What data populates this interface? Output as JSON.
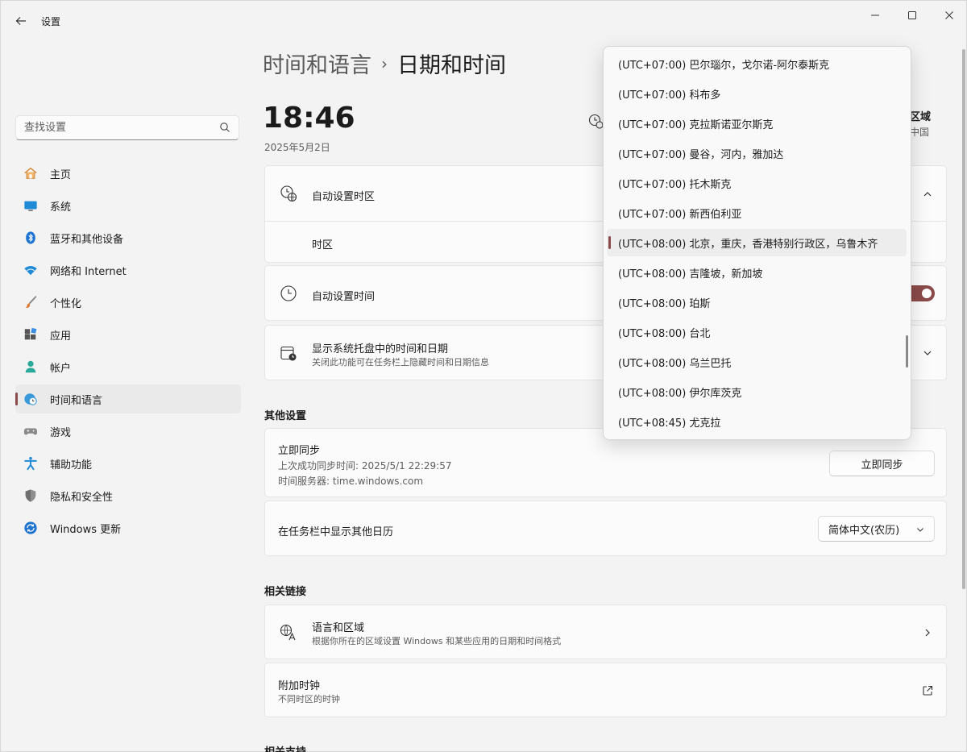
{
  "app": {
    "title": "设置"
  },
  "search": {
    "placeholder": "查找设置"
  },
  "sidebar": {
    "items": [
      {
        "label": "主页"
      },
      {
        "label": "系统"
      },
      {
        "label": "蓝牙和其他设备"
      },
      {
        "label": "网络和 Internet"
      },
      {
        "label": "个性化"
      },
      {
        "label": "应用"
      },
      {
        "label": "帐户"
      },
      {
        "label": "时间和语言"
      },
      {
        "label": "游戏"
      },
      {
        "label": "辅助功能"
      },
      {
        "label": "隐私和安全性"
      },
      {
        "label": "Windows 更新"
      }
    ],
    "active_index": 7
  },
  "breadcrumb": {
    "parent": "时间和语言",
    "separator": "›",
    "current": "日期和时间"
  },
  "clock": {
    "time": "18:46",
    "date": "2025年5月2日"
  },
  "region": {
    "label": "区域",
    "value": "中国"
  },
  "settings": {
    "auto_timezone": {
      "title": "自动设置时区"
    },
    "timezone": {
      "title": "时区"
    },
    "auto_time": {
      "title": "自动设置时间",
      "on": true
    },
    "tray": {
      "title": "显示系统托盘中的时间和日期",
      "subtitle": "关闭此功能可在任务栏上隐藏时间和日期信息"
    }
  },
  "other": {
    "heading": "其他设置",
    "sync": {
      "title": "立即同步",
      "last_sync": "上次成功同步时间: 2025/5/1 22:29:57",
      "server": "时间服务器: time.windows.com",
      "button": "立即同步"
    },
    "calendar": {
      "title": "在任务栏中显示其他日历",
      "value": "简体中文(农历)"
    }
  },
  "related": {
    "heading": "相关链接",
    "language": {
      "title": "语言和区域",
      "subtitle": "根据你所在的区域设置 Windows 和某些应用的日期和时间格式"
    },
    "clocks": {
      "title": "附加时钟",
      "subtitle": "不同时区的时钟"
    }
  },
  "support": {
    "heading": "相关支持"
  },
  "dropdown": {
    "items": [
      "(UTC+07:00) 巴尔瑙尔，戈尔诺-阿尔泰斯克",
      "(UTC+07:00) 科布多",
      "(UTC+07:00) 克拉斯诺亚尔斯克",
      "(UTC+07:00) 曼谷，河内，雅加达",
      "(UTC+07:00) 托木斯克",
      "(UTC+07:00) 新西伯利亚",
      "(UTC+08:00) 北京，重庆，香港特别行政区，乌鲁木齐",
      "(UTC+08:00) 吉隆坡，新加坡",
      "(UTC+08:00) 珀斯",
      "(UTC+08:00) 台北",
      "(UTC+08:00) 乌兰巴托",
      "(UTC+08:00) 伊尔库茨克",
      "(UTC+08:45) 尤克拉"
    ],
    "selected_index": 6
  },
  "colors": {
    "accent": "#8b4a4a",
    "background": "#f3f3f3",
    "card": "#fbfbfb"
  }
}
